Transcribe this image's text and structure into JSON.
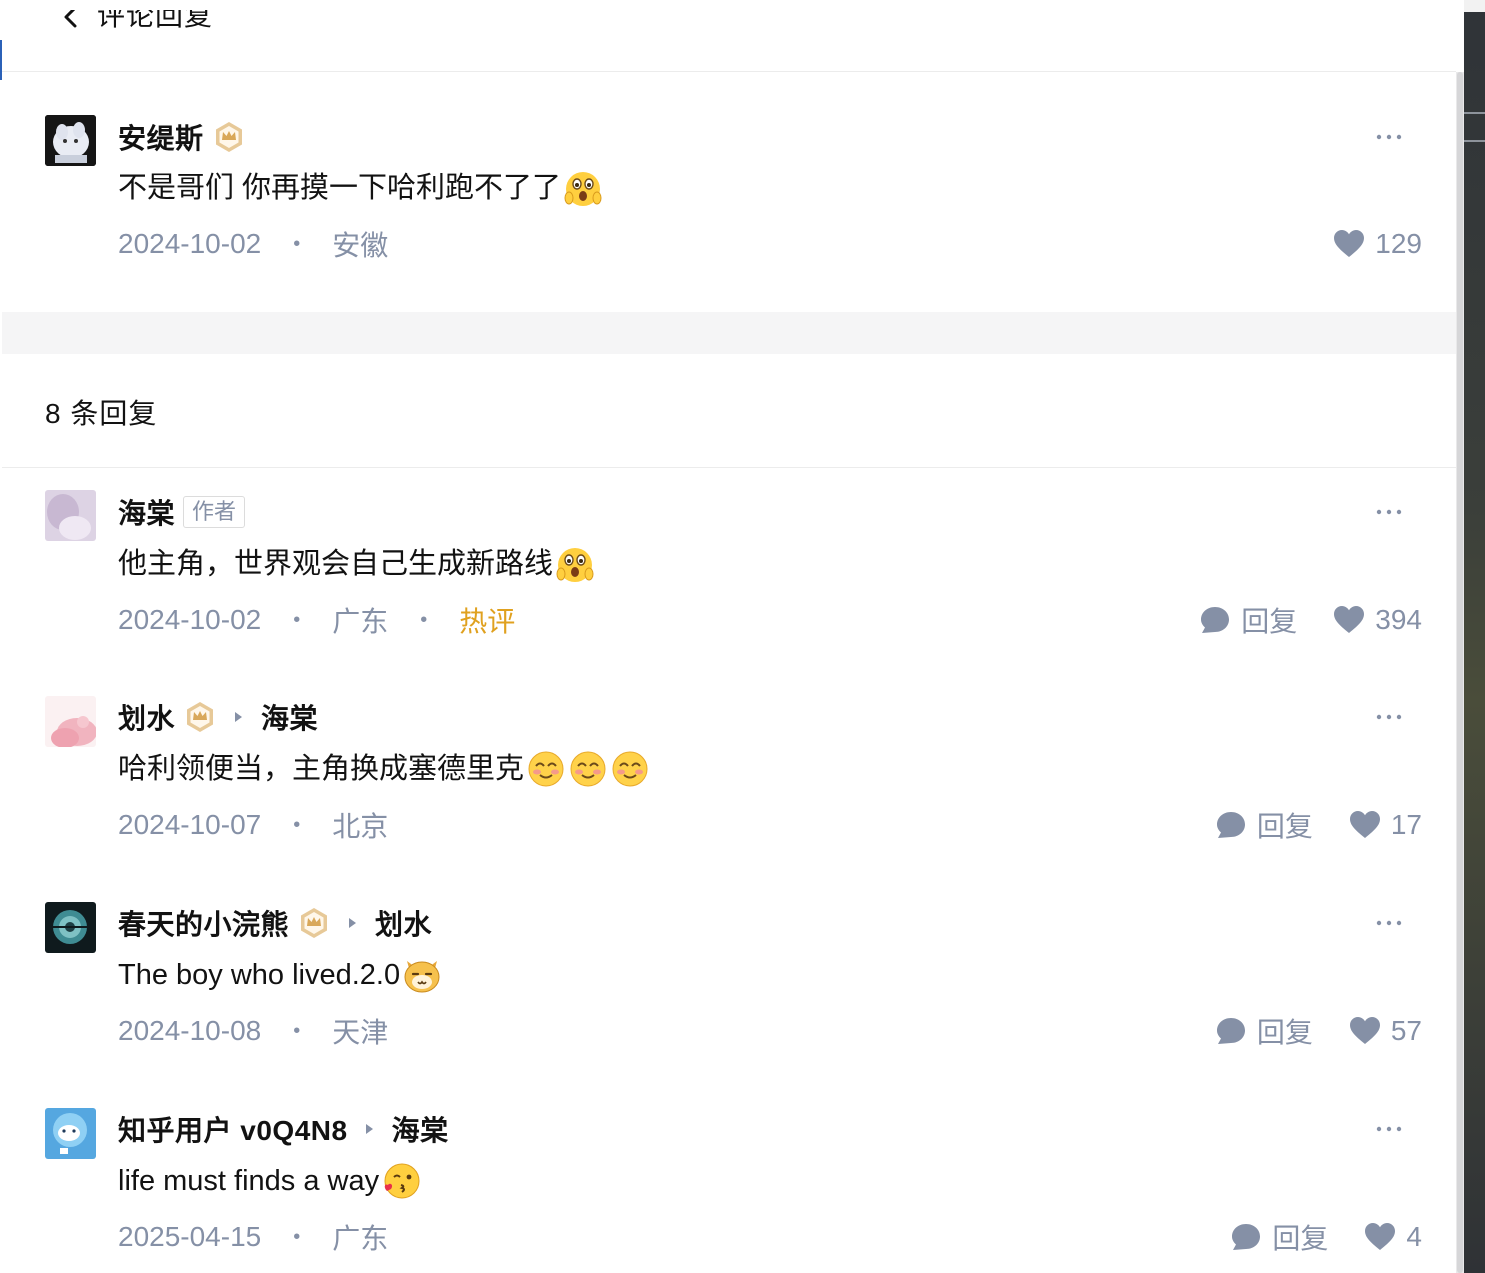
{
  "header": {
    "title": "评论回复"
  },
  "root_comment": {
    "author": "安缇斯",
    "content": "不是哥们  你再摸一下哈利跑不了了",
    "emoji": "shocked-face-emoji",
    "date": "2024-10-02",
    "location": "安徽",
    "likes": "129"
  },
  "replies_count": "8  条回复",
  "replies": [
    {
      "author": "海棠",
      "author_tag": "作者",
      "content": "他主角，世界观会自己生成新路线",
      "date": "2024-10-02",
      "location": "广东",
      "hot_label": "热评",
      "reply_label": "回复",
      "likes": "394"
    },
    {
      "author": "划水",
      "reply_to": "海棠",
      "content": "哈利领便当，主角换成塞德里克",
      "date": "2024-10-07",
      "location": "北京",
      "reply_label": "回复",
      "likes": "17"
    },
    {
      "author": "春天的小浣熊",
      "reply_to": "划水",
      "content": "The  boy  who  lived.2.0",
      "date": "2024-10-08",
      "location": "天津",
      "reply_label": "回复",
      "likes": "57"
    },
    {
      "author": "知乎用户 v0Q4N8",
      "reply_to": "海棠",
      "content": "life  must  finds  a  way",
      "date": "2025-04-15",
      "location": "广东",
      "reply_label": "回复",
      "likes": "4"
    }
  ],
  "colors": {
    "meta_gray": "#8590a6",
    "hot_orange": "#e0a11f",
    "badge_gold": "#d9a85a"
  }
}
